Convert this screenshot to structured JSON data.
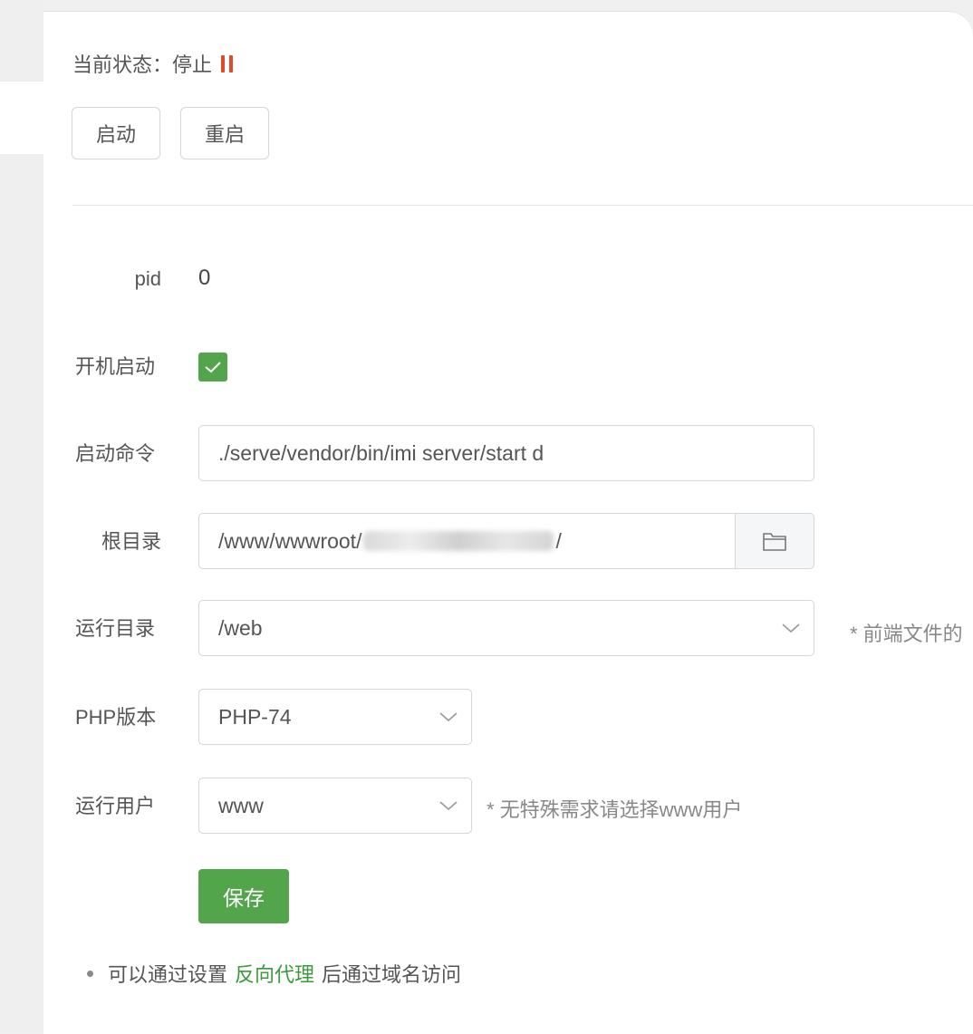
{
  "status": {
    "label": "当前状态：",
    "value": "停止",
    "icon": "pause-icon",
    "icon_color": "#e04a2a"
  },
  "actions": {
    "start_label": "启动",
    "restart_label": "重启"
  },
  "form": {
    "pid": {
      "label": "pid",
      "value": "0"
    },
    "autostart": {
      "label": "开机启动",
      "checked": true
    },
    "command": {
      "label": "启动命令",
      "value": "./serve/vendor/bin/imi server/start d"
    },
    "root_dir": {
      "label": "根目录",
      "value_prefix": "/www/wwwroot/",
      "value_suffix": "/",
      "icon": "folder-icon"
    },
    "run_dir": {
      "label": "运行目录",
      "value": "/web",
      "hint": "* 前端文件的"
    },
    "php_version": {
      "label": "PHP版本",
      "value": "PHP-74"
    },
    "run_user": {
      "label": "运行用户",
      "value": "www",
      "hint": "* 无特殊需求请选择www用户"
    },
    "save_label": "保存"
  },
  "note": {
    "before": "可以通过设置",
    "link": "反向代理",
    "after": "后通过域名访问"
  },
  "colors": {
    "accent": "#52a54a",
    "link": "#3c9a3a",
    "stop": "#e04a2a"
  }
}
